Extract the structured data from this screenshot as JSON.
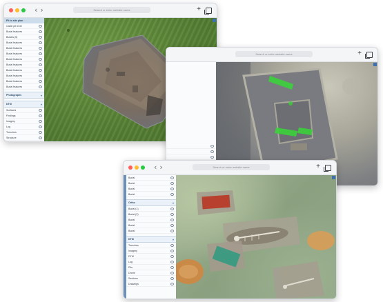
{
  "browser": {
    "url_placeholder": "Search or enter website name",
    "back_icon": "chevron-left-icon",
    "forward_icon": "chevron-right-icon",
    "new_tab_icon": "plus-icon",
    "tabs_icon": "tabs-icon"
  },
  "win1": {
    "sidebar_header": "Fit to site plan",
    "sidebar_items": [
      "Cable pit level",
      "Burial features",
      "Burials (5)",
      "Burial features",
      "Burial features",
      "Burial features",
      "Burial features",
      "Burial features",
      "Burial features",
      "Burial features",
      "Burial features",
      "Burial features"
    ],
    "groups": [
      "Photographs",
      "DTM",
      "Surfaces",
      "Findings",
      "Imagery",
      "Log",
      "Trenches",
      "Structure"
    ]
  },
  "win2": {
    "sidebar_items": [
      "",
      "",
      "",
      "",
      "",
      ""
    ]
  },
  "win3": {
    "sidebar_items": [
      "Burial",
      "Burial",
      "Burial",
      "Burial"
    ],
    "groups": [
      "Ortho",
      "DTM"
    ],
    "sub_items": [
      "Burial (1)",
      "Burial (2)",
      "Burial",
      "Burial",
      "Burial"
    ],
    "more_groups": [
      "Trenches",
      "Imagery",
      "DTM",
      "Log",
      "Pits",
      "Drone",
      "Sections",
      "Drawings"
    ]
  },
  "colors": {
    "accent": "#6c8fba",
    "green_overlay": "#3ad13a",
    "red_slab": "#b7412e",
    "teal_slab": "#3f9a82",
    "orange_pit": "#c98a48"
  }
}
